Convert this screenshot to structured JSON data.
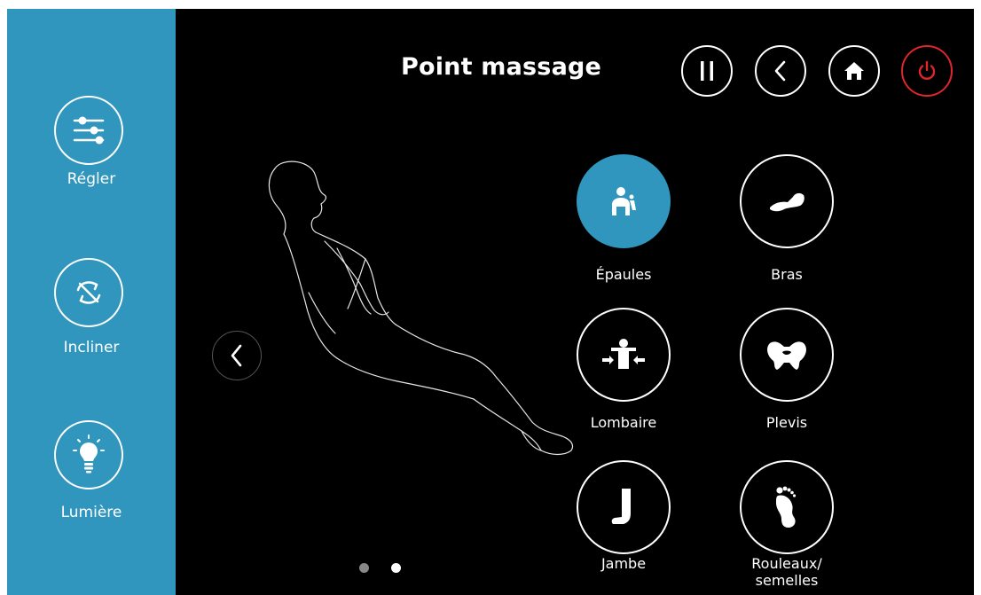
{
  "header": {
    "title": "Point massage"
  },
  "sidebar": {
    "items": [
      {
        "label": "Régler",
        "icon": "sliders-icon"
      },
      {
        "label": "Incliner",
        "icon": "recline-icon"
      },
      {
        "label": "Lumière",
        "icon": "light-bulb-icon"
      }
    ]
  },
  "toolbar": {
    "buttons": [
      {
        "icon": "pause-icon"
      },
      {
        "icon": "back-icon"
      },
      {
        "icon": "home-icon"
      },
      {
        "icon": "power-icon"
      }
    ]
  },
  "zones": [
    {
      "label": "Épaules",
      "icon": "shoulders-icon",
      "selected": true
    },
    {
      "label": "Bras",
      "icon": "arm-icon",
      "selected": false
    },
    {
      "label": "Lombaire",
      "icon": "lumbar-icon",
      "selected": false
    },
    {
      "label": "Plevis",
      "icon": "pelvis-icon",
      "selected": false
    },
    {
      "label": "Jambe",
      "icon": "leg-icon",
      "selected": false
    },
    {
      "label": "Rouleaux/ semelles",
      "icon": "foot-icon",
      "selected": false
    }
  ],
  "pagination": {
    "pages": 2,
    "current": 2
  },
  "colors": {
    "accent": "#3096bd",
    "background": "#000000",
    "power": "#e0262a",
    "text": "#ffffff"
  }
}
